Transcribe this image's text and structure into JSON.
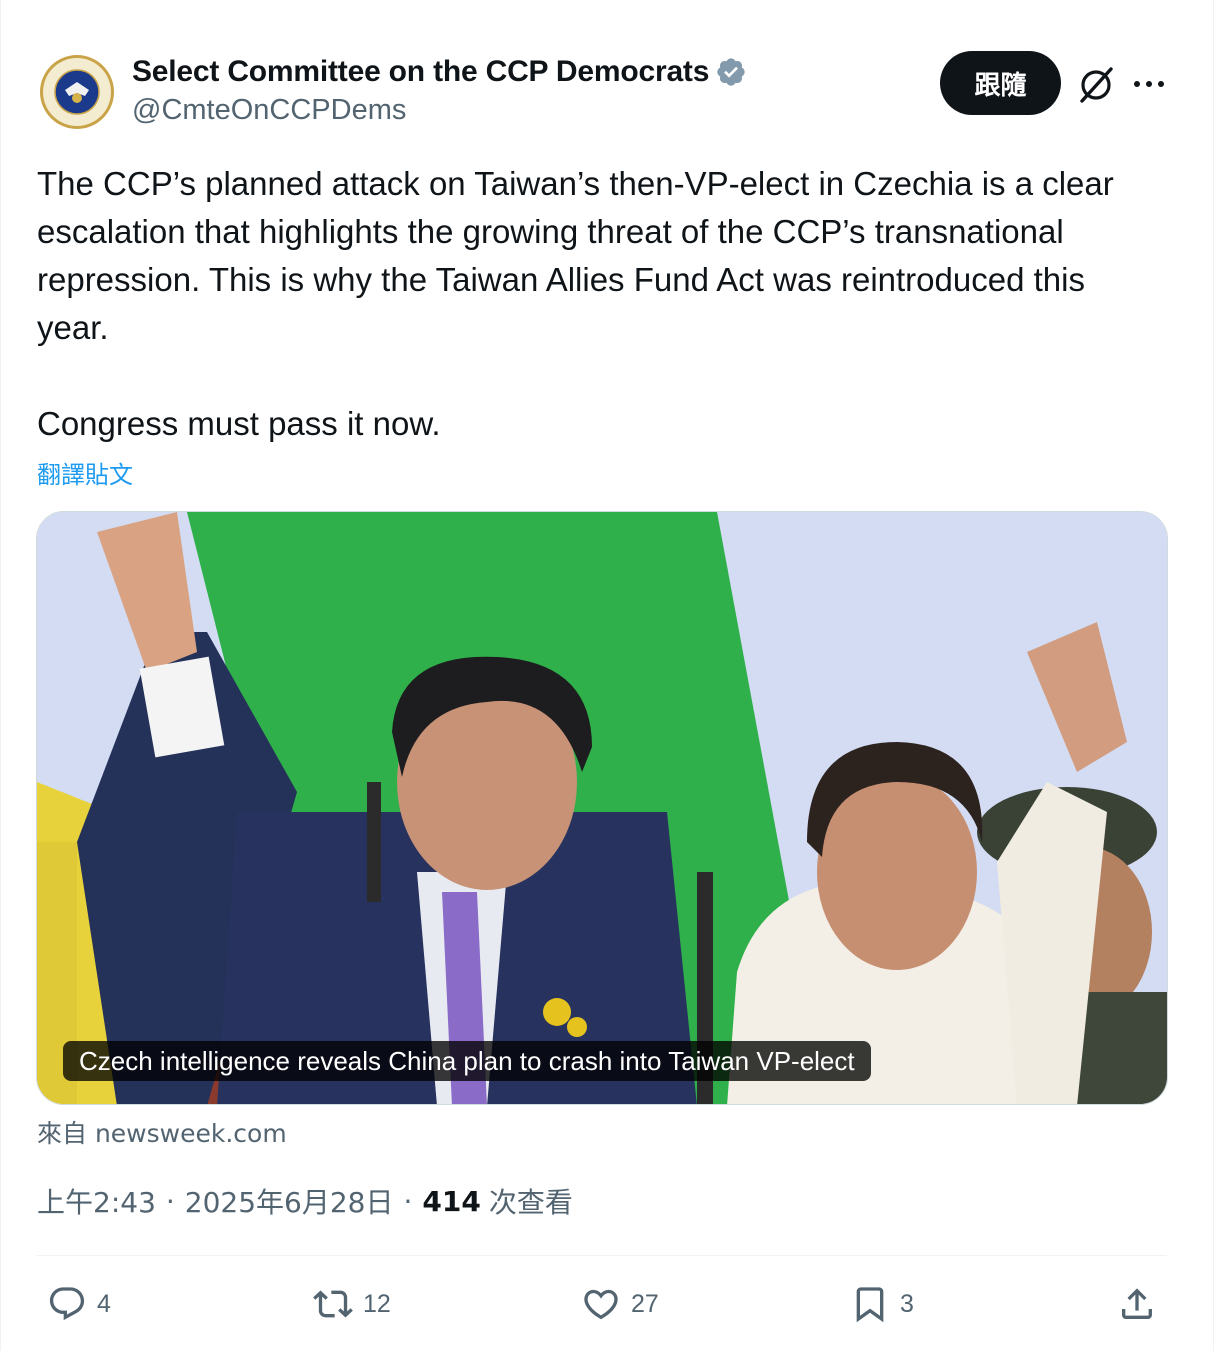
{
  "author": {
    "display_name": "Select Committee on the CCP Democrats",
    "handle": "@CmteOnCCPDems",
    "avatar_icon": "committee-seal-icon",
    "avatar_text": "SELECT COMMITTEE ON THE CCP Democrats",
    "verified_icon": "verified-badge-icon",
    "verified_color": "#829aab"
  },
  "header_actions": {
    "follow_label": "跟隨",
    "grok_icon": "grok-icon",
    "more_icon": "more-dots-icon"
  },
  "tweet": {
    "text": "The CCP’s planned attack on Taiwan’s then-VP-elect in Czechia is a clear escalation that highlights the growing threat of the CCP’s transnational repression. This is why the Taiwan Allies Fund Act was reintroduced this year.\n\nCongress must pass it now.",
    "translate_label": "翻譯貼文"
  },
  "link_card": {
    "caption": "Czech intelligence reveals China plan to crash into Taiwan VP-elect",
    "source_label": "來自 newsweek.com"
  },
  "meta": {
    "time": "上午2:43",
    "dot": "·",
    "date": "2025年6月28日",
    "views_count": "414",
    "views_label": "次查看"
  },
  "actions": {
    "reply": {
      "icon": "reply-icon",
      "count": "4"
    },
    "retweet": {
      "icon": "retweet-icon",
      "count": "12"
    },
    "like": {
      "icon": "heart-icon",
      "count": "27"
    },
    "bookmark": {
      "icon": "bookmark-icon",
      "count": "3"
    },
    "share": {
      "icon": "share-icon"
    }
  },
  "colors": {
    "text_primary": "#0f1419",
    "text_secondary": "#536471",
    "link": "#1d9bf0",
    "follow_bg": "#0f1419"
  }
}
